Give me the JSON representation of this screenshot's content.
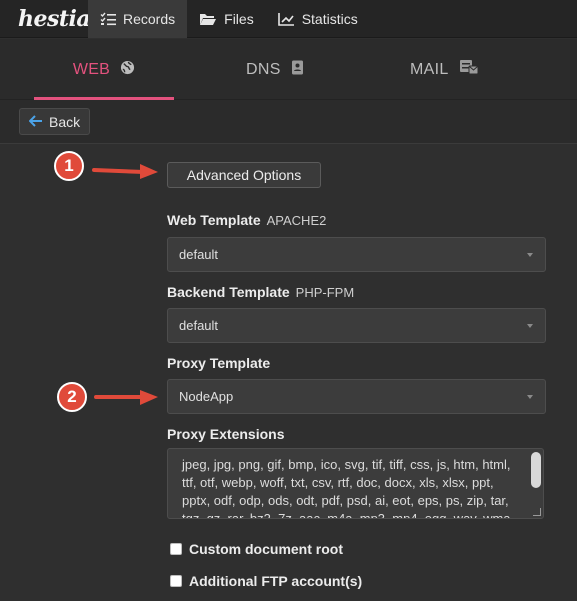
{
  "app": {
    "logo": "hestia",
    "nav": [
      {
        "label": "Records",
        "icon": "checklist-icon",
        "active": true
      },
      {
        "label": "Files",
        "icon": "folder-icon",
        "active": false
      },
      {
        "label": "Statistics",
        "icon": "chart-icon",
        "active": false
      }
    ]
  },
  "tabs": [
    {
      "label": "WEB",
      "icon": "globe-icon",
      "active": true
    },
    {
      "label": "DNS",
      "icon": "address-book-icon",
      "active": false
    },
    {
      "label": "MAIL",
      "icon": "mail-server-icon",
      "active": false
    }
  ],
  "toolbar": {
    "back_label": "Back"
  },
  "form": {
    "advanced_options_label": "Advanced Options",
    "web_template": {
      "label": "Web Template",
      "sublabel": "APACHE2",
      "value": "default"
    },
    "backend_template": {
      "label": "Backend Template",
      "sublabel": "PHP-FPM",
      "value": "default"
    },
    "proxy_template": {
      "label": "Proxy Template",
      "value": "NodeApp"
    },
    "proxy_extensions": {
      "label": "Proxy Extensions",
      "value": "jpeg, jpg, png, gif, bmp, ico, svg, tif, tiff, css, js, htm, html, ttf, otf, webp, woff, txt, csv, rtf, doc, docx, xls, xlsx, ppt, pptx, odf, odp, ods, odt, pdf, psd, ai, eot, eps, ps, zip, tar, tgz, gz, rar, bz2, 7z, aac, m4a, mp3, mp4, ogg, wav, wma"
    },
    "custom_document_root": {
      "label": "Custom document root",
      "checked": false
    },
    "additional_ftp": {
      "label": "Additional FTP account(s)",
      "checked": false
    }
  },
  "callouts": [
    "1",
    "2"
  ],
  "colors": {
    "accent": "#e3527e",
    "callout": "#e04a3a",
    "background": "#2f2f2f"
  }
}
